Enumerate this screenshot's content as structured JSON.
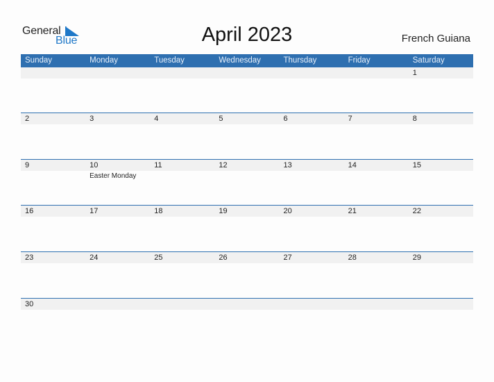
{
  "logo": {
    "line1": "General",
    "line2": "Blue",
    "accent_color": "#1f78c8"
  },
  "title": "April 2023",
  "country": "French Guiana",
  "colors": {
    "header_bg": "#2e6fb0",
    "day_bar_bg": "#f1f1f1"
  },
  "weekdays": [
    "Sunday",
    "Monday",
    "Tuesday",
    "Wednesday",
    "Thursday",
    "Friday",
    "Saturday"
  ],
  "weeks": [
    [
      {
        "day": ""
      },
      {
        "day": ""
      },
      {
        "day": ""
      },
      {
        "day": ""
      },
      {
        "day": ""
      },
      {
        "day": ""
      },
      {
        "day": "1"
      }
    ],
    [
      {
        "day": "2"
      },
      {
        "day": "3"
      },
      {
        "day": "4"
      },
      {
        "day": "5"
      },
      {
        "day": "6"
      },
      {
        "day": "7"
      },
      {
        "day": "8"
      }
    ],
    [
      {
        "day": "9"
      },
      {
        "day": "10",
        "event": "Easter Monday"
      },
      {
        "day": "11"
      },
      {
        "day": "12"
      },
      {
        "day": "13"
      },
      {
        "day": "14"
      },
      {
        "day": "15"
      }
    ],
    [
      {
        "day": "16"
      },
      {
        "day": "17"
      },
      {
        "day": "18"
      },
      {
        "day": "19"
      },
      {
        "day": "20"
      },
      {
        "day": "21"
      },
      {
        "day": "22"
      }
    ],
    [
      {
        "day": "23"
      },
      {
        "day": "24"
      },
      {
        "day": "25"
      },
      {
        "day": "26"
      },
      {
        "day": "27"
      },
      {
        "day": "28"
      },
      {
        "day": "29"
      }
    ],
    [
      {
        "day": "30"
      },
      {
        "day": ""
      },
      {
        "day": ""
      },
      {
        "day": ""
      },
      {
        "day": ""
      },
      {
        "day": ""
      },
      {
        "day": ""
      }
    ]
  ]
}
